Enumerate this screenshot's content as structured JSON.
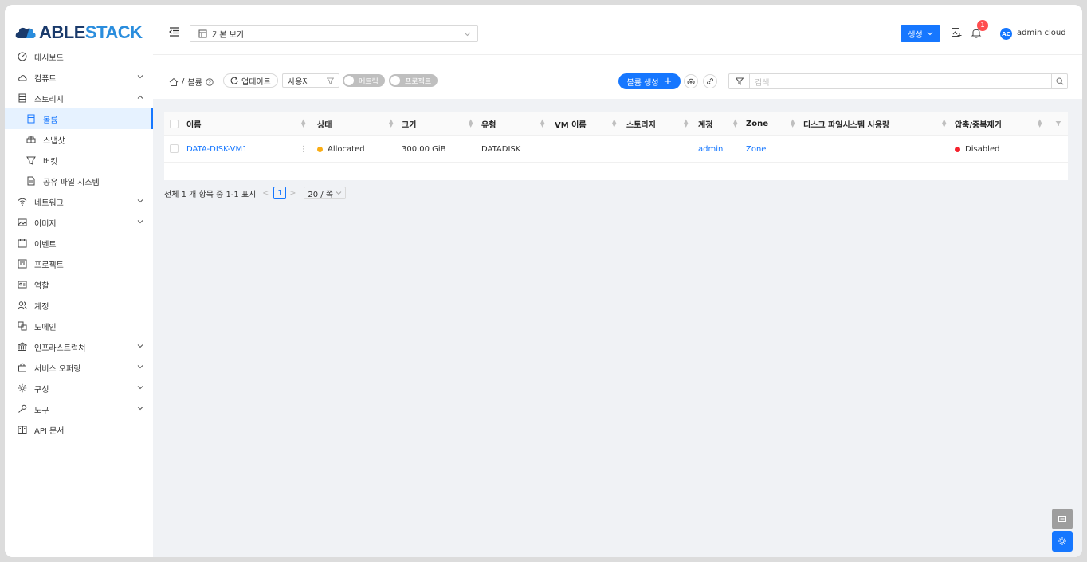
{
  "app": {
    "logo_part1": "ABLE",
    "logo_part2": "STACK"
  },
  "sidebar": {
    "items": [
      {
        "label": "대시보드",
        "icon": "dashboard-icon",
        "expandable": false
      },
      {
        "label": "컴퓨트",
        "icon": "cloud-icon",
        "expandable": true
      },
      {
        "label": "스토리지",
        "icon": "storage-icon",
        "expandable": true,
        "expanded": true
      },
      {
        "label": "볼륨",
        "icon": "volume-icon",
        "sub": true,
        "active": true
      },
      {
        "label": "스냅샷",
        "icon": "snapshot-icon",
        "sub": true
      },
      {
        "label": "버킷",
        "icon": "bucket-icon",
        "sub": true
      },
      {
        "label": "공유 파일 시스템",
        "icon": "file-icon",
        "sub": true
      },
      {
        "label": "네트워크",
        "icon": "wifi-icon",
        "expandable": true
      },
      {
        "label": "이미지",
        "icon": "image-icon",
        "expandable": true
      },
      {
        "label": "이벤트",
        "icon": "calendar-icon"
      },
      {
        "label": "프로젝트",
        "icon": "project-icon"
      },
      {
        "label": "역할",
        "icon": "role-icon"
      },
      {
        "label": "계정",
        "icon": "users-icon"
      },
      {
        "label": "도메인",
        "icon": "domain-icon"
      },
      {
        "label": "인프라스트럭쳐",
        "icon": "bank-icon",
        "expandable": true
      },
      {
        "label": "서비스 오퍼링",
        "icon": "shopping-icon",
        "expandable": true
      },
      {
        "label": "구성",
        "icon": "gear-icon",
        "expandable": true
      },
      {
        "label": "도구",
        "icon": "tool-icon",
        "expandable": true
      },
      {
        "label": "API 문서",
        "icon": "book-icon"
      }
    ]
  },
  "header": {
    "view_select": "기본 보기",
    "create_label": "생성",
    "notification_count": "1",
    "avatar_initials": "AC",
    "username": "admin cloud"
  },
  "toolbar": {
    "breadcrumb_sep": "/",
    "breadcrumb_current": "볼륨",
    "refresh_label": "업데이트",
    "scope_value": "사용자",
    "toggle_metrics": "메트릭",
    "toggle_project": "프로젝트",
    "volume_create_label": "볼륨 생성",
    "search_placeholder": "검색"
  },
  "table": {
    "columns": [
      "이름",
      "상태",
      "크기",
      "유형",
      "VM 이름",
      "스토리지",
      "계정",
      "Zone",
      "디스크 파일시스템 사용량",
      "압축/중복제거"
    ],
    "rows": [
      {
        "name": "DATA-DISK-VM1",
        "state": "Allocated",
        "size": "300.00 GiB",
        "type": "DATADISK",
        "vm_name": "",
        "storage": "",
        "account": "admin",
        "zone": "Zone",
        "disk_usage": "",
        "compression": "Disabled"
      }
    ]
  },
  "pagination": {
    "summary": "전체 1 개 항목 중 1-1 표시",
    "current_page": "1",
    "page_size": "20 / 쪽"
  },
  "colors": {
    "primary": "#1677ff",
    "allocated": "#faad14",
    "disabled": "#f5222d"
  }
}
